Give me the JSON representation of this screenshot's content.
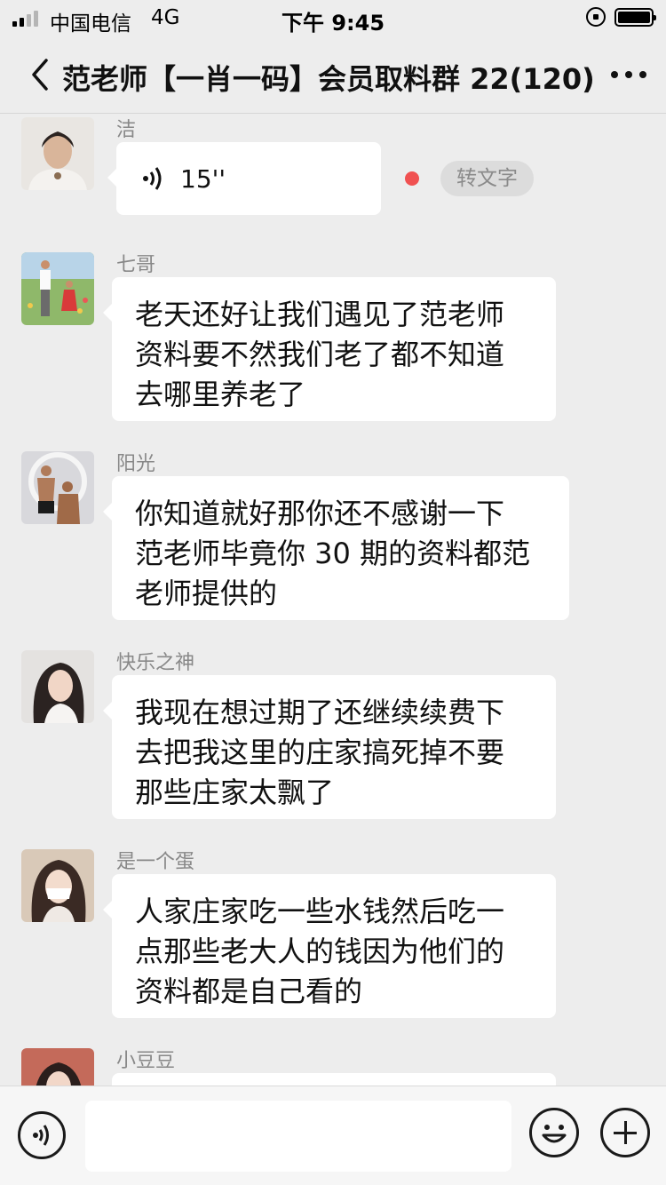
{
  "status_bar": {
    "carrier": "中国电信",
    "network": "4G",
    "time": "下午 9:45"
  },
  "header": {
    "back_icon": "chevron-left-icon",
    "title": "范老师【一肖一码】会员取料群 22(120)",
    "more_icon": "ellipsis-icon"
  },
  "messages": [
    {
      "sender": "洁",
      "type": "voice",
      "duration": "15''",
      "convert_label": "转文字",
      "unread": true
    },
    {
      "sender": "七哥",
      "type": "text",
      "lines": [
        "老天还好让我们遇见了范老师",
        "资料要不然我们老了都不知道",
        "去哪里养老了"
      ]
    },
    {
      "sender": "阳光",
      "type": "text",
      "lines": [
        "你知道就好那你还不感谢一下",
        "范老师毕竟你 30 期的资料都范",
        "老师提供的"
      ]
    },
    {
      "sender": "快乐之神",
      "type": "text",
      "lines": [
        "我现在想过期了还继续续费下",
        "去把我这里的庄家搞死掉不要",
        "那些庄家太飘了"
      ]
    },
    {
      "sender": "是一个蛋",
      "type": "text",
      "lines": [
        "人家庄家吃一些水钱然后吃一",
        "点那些老大人的钱因为他们的",
        "资料都是自己看的"
      ]
    },
    {
      "sender": "小豆豆",
      "type": "text",
      "lines": []
    }
  ],
  "input_bar": {
    "voice_icon": "voice-mode-icon",
    "input_value": "",
    "emoji_icon": "emoji-icon",
    "plus_icon": "plus-icon"
  },
  "colors": {
    "background": "#ededed",
    "bubble": "#ffffff",
    "unread_dot": "#f05151",
    "text": "#111111",
    "sender_name": "#888888"
  }
}
